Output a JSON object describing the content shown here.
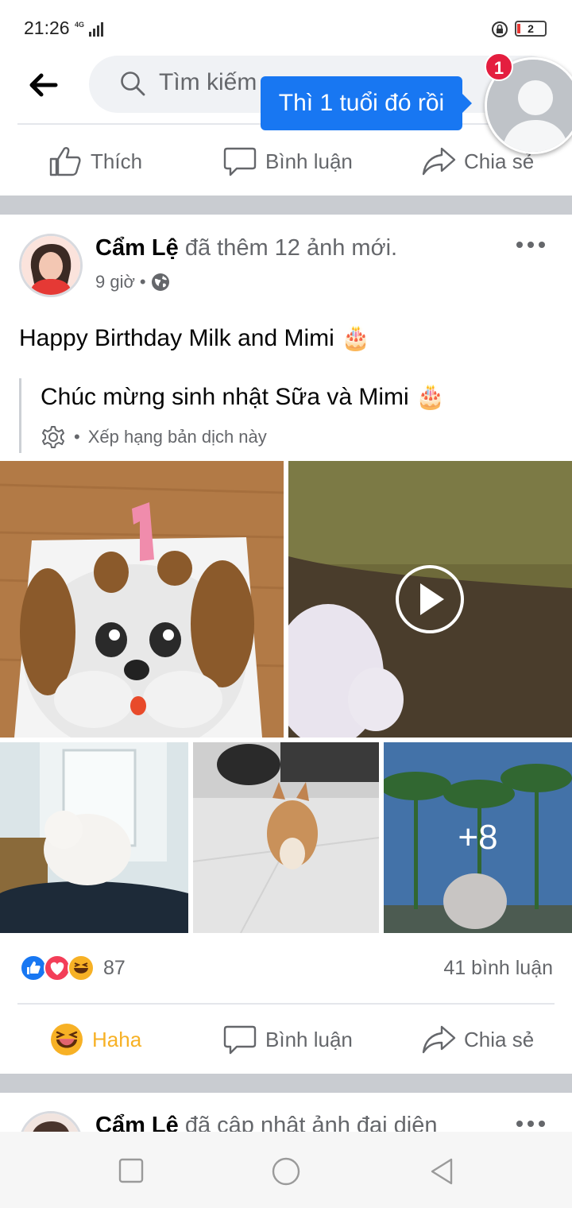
{
  "status_bar": {
    "time": "21:26",
    "network": "4G",
    "battery": "2"
  },
  "top_bar": {
    "search_placeholder": "Tìm kiếm"
  },
  "chat_head": {
    "badge": "1",
    "tooltip": "Thì 1 tuổi đó rồi"
  },
  "prev_actions": {
    "like": "Thích",
    "comment": "Bình luận",
    "share": "Chia sẻ"
  },
  "post": {
    "author": "Cẩm Lệ",
    "action": "đã thêm 12 ảnh mới.",
    "time": "9 giờ",
    "separator": "•",
    "text": "Happy Birthday Milk and Mimi 🎂",
    "translation": "Chúc mừng sinh nhật Sữa và Mimi 🎂",
    "translation_meta": "Xếp hạng bản dịch này",
    "more_photos": "+8",
    "reaction_count": "87",
    "comment_count": "41 bình luận",
    "actions": {
      "reaction": "Haha",
      "comment": "Bình luận",
      "share": "Chia sẻ"
    }
  },
  "next_post": {
    "author": "Cẩm Lệ",
    "action": "đã cập nhật ảnh đại diện"
  },
  "colors": {
    "accent": "#1877f2",
    "haha": "#f7b125",
    "badge": "#e41e3f"
  }
}
